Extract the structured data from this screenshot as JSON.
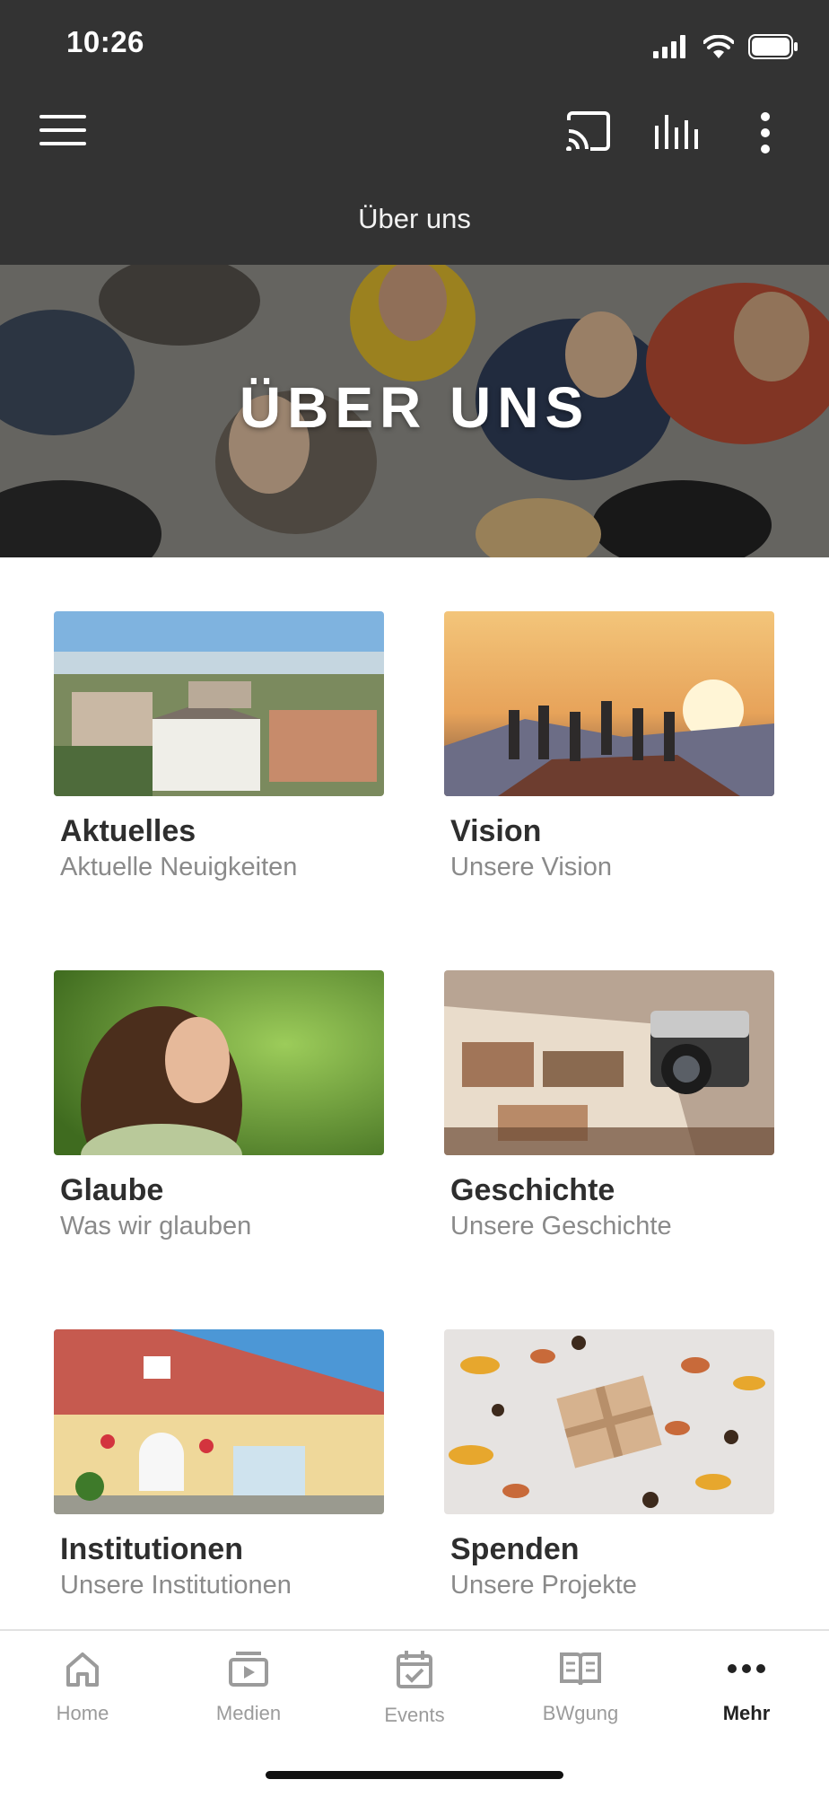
{
  "status_bar": {
    "time": "10:26"
  },
  "header": {
    "title": "Über uns"
  },
  "hero": {
    "title": "ÜBER UNS"
  },
  "cards": [
    {
      "title": "Aktuelles",
      "subtitle": "Aktuelle Neuigkeiten",
      "image": "city-aerial-image"
    },
    {
      "title": "Vision",
      "subtitle": "Unsere Vision",
      "image": "people-sunset-image"
    },
    {
      "title": "Glaube",
      "subtitle": "Was wir glauben",
      "image": "woman-forest-image"
    },
    {
      "title": "Geschichte",
      "subtitle": "Unsere Geschichte",
      "image": "camera-photo-album-image"
    },
    {
      "title": "Institutionen",
      "subtitle": "Unsere Institutionen",
      "image": "building-image"
    },
    {
      "title": "Spenden",
      "subtitle": "Unsere Projekte",
      "image": "gift-autumn-image"
    }
  ],
  "bottom_nav": {
    "items": [
      {
        "label": "Home",
        "icon": "home-icon"
      },
      {
        "label": "Medien",
        "icon": "media-icon"
      },
      {
        "label": "Events",
        "icon": "calendar-icon"
      },
      {
        "label": "BWgung",
        "icon": "book-icon"
      },
      {
        "label": "Mehr",
        "icon": "more-dots-icon",
        "active": true
      }
    ]
  },
  "colors": {
    "header_bg": "#333333",
    "active_nav": "#222222",
    "inactive_nav": "#9b9b9b"
  }
}
